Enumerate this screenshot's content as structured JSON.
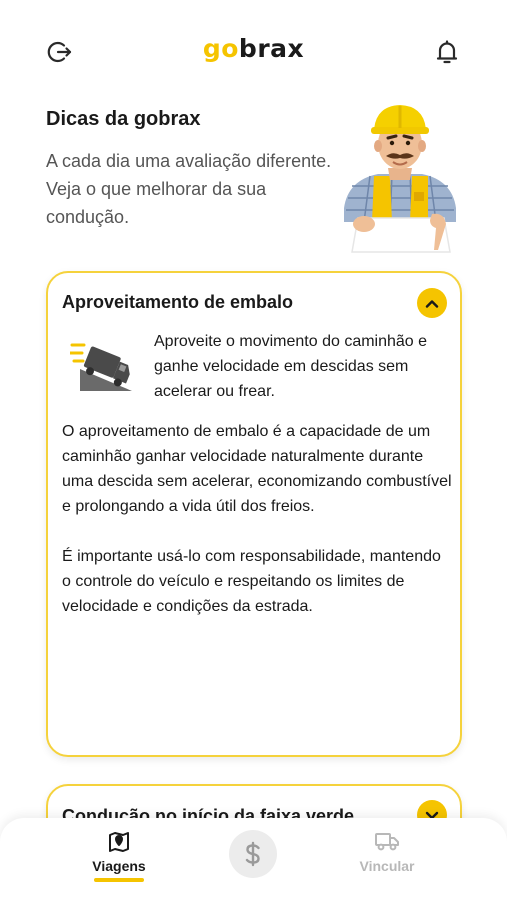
{
  "app": {
    "logo_go": "go",
    "logo_brax": "brax"
  },
  "intro": {
    "title": "Dicas da gobrax",
    "text": "A cada dia uma avaliação diferente. Veja o que melhorar da sua condução."
  },
  "tips": [
    {
      "title": "Aproveitamento de embalo",
      "expanded": true,
      "icon": "truck-downhill-icon",
      "summary": "Aproveite o movimento do caminhão e ganhe velocidade em descidas sem acelerar ou frear.",
      "body": [
        "O aproveitamento de embalo é a capacidade de um caminhão ganhar velocidade naturalmente durante uma descida sem acelerar, economizando combustível e prolongando a vida útil dos freios.",
        "É importante usá-lo com responsabilidade, mantendo o controle do veículo e respeitando os limites de velocidade e condições da estrada."
      ]
    },
    {
      "title": "Condução no início da faixa verde",
      "expanded": false
    }
  ],
  "nav": {
    "trips_label": "Viagens",
    "link_label": "Vincular",
    "center_icon": "dollar-icon"
  },
  "colors": {
    "accent": "#f5c400",
    "text": "#1a1a1a",
    "muted": "#555555",
    "inactive": "#b8b8b8"
  }
}
